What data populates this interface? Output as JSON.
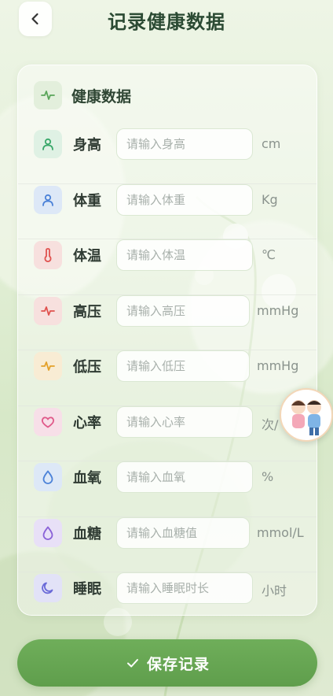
{
  "header": {
    "title": "记录健康数据"
  },
  "section": {
    "title": "健康数据"
  },
  "fields": [
    {
      "key": "height",
      "label": "身高",
      "placeholder": "请输入身高",
      "unit": "cm",
      "icon": "person-icon",
      "color": "#3aa86a",
      "bg": "#dff1e4"
    },
    {
      "key": "weight",
      "label": "体重",
      "placeholder": "请输入体重",
      "unit": "Kg",
      "icon": "person-icon",
      "color": "#4c82d8",
      "bg": "#dde8f7"
    },
    {
      "key": "temperature",
      "label": "体温",
      "placeholder": "请输入体温",
      "unit": "℃",
      "icon": "thermometer-icon",
      "color": "#e0524f",
      "bg": "#f7e0de"
    },
    {
      "key": "systolic",
      "label": "高压",
      "placeholder": "请输入高压",
      "unit": "mmHg",
      "icon": "pulse-icon",
      "color": "#e0524f",
      "bg": "#f7e0de"
    },
    {
      "key": "diastolic",
      "label": "低压",
      "placeholder": "请输入低压",
      "unit": "mmHg",
      "icon": "pulse-icon",
      "color": "#e3a12a",
      "bg": "#f8ecd4"
    },
    {
      "key": "heart_rate",
      "label": "心率",
      "placeholder": "请输入心率",
      "unit": "次/",
      "icon": "heart-icon",
      "color": "#e05a8a",
      "bg": "#f7dfe8"
    },
    {
      "key": "blood_oxygen",
      "label": "血氧",
      "placeholder": "请输入血氧",
      "unit": "%",
      "icon": "droplet-icon",
      "color": "#4c82d8",
      "bg": "#dde8f7"
    },
    {
      "key": "blood_sugar",
      "label": "血糖",
      "placeholder": "请输入血糖值",
      "unit": "mmol/L",
      "icon": "droplet-icon",
      "color": "#8a62d8",
      "bg": "#e8e0f7"
    },
    {
      "key": "sleep",
      "label": "睡眠",
      "placeholder": "请输入睡眠时长",
      "unit": "小时",
      "icon": "moon-icon",
      "color": "#6a6ad8",
      "bg": "#e2e2f7"
    }
  ],
  "actions": {
    "save_label": "保存记录"
  },
  "colors": {
    "accent": "#65a552",
    "title": "#2b4a33"
  }
}
